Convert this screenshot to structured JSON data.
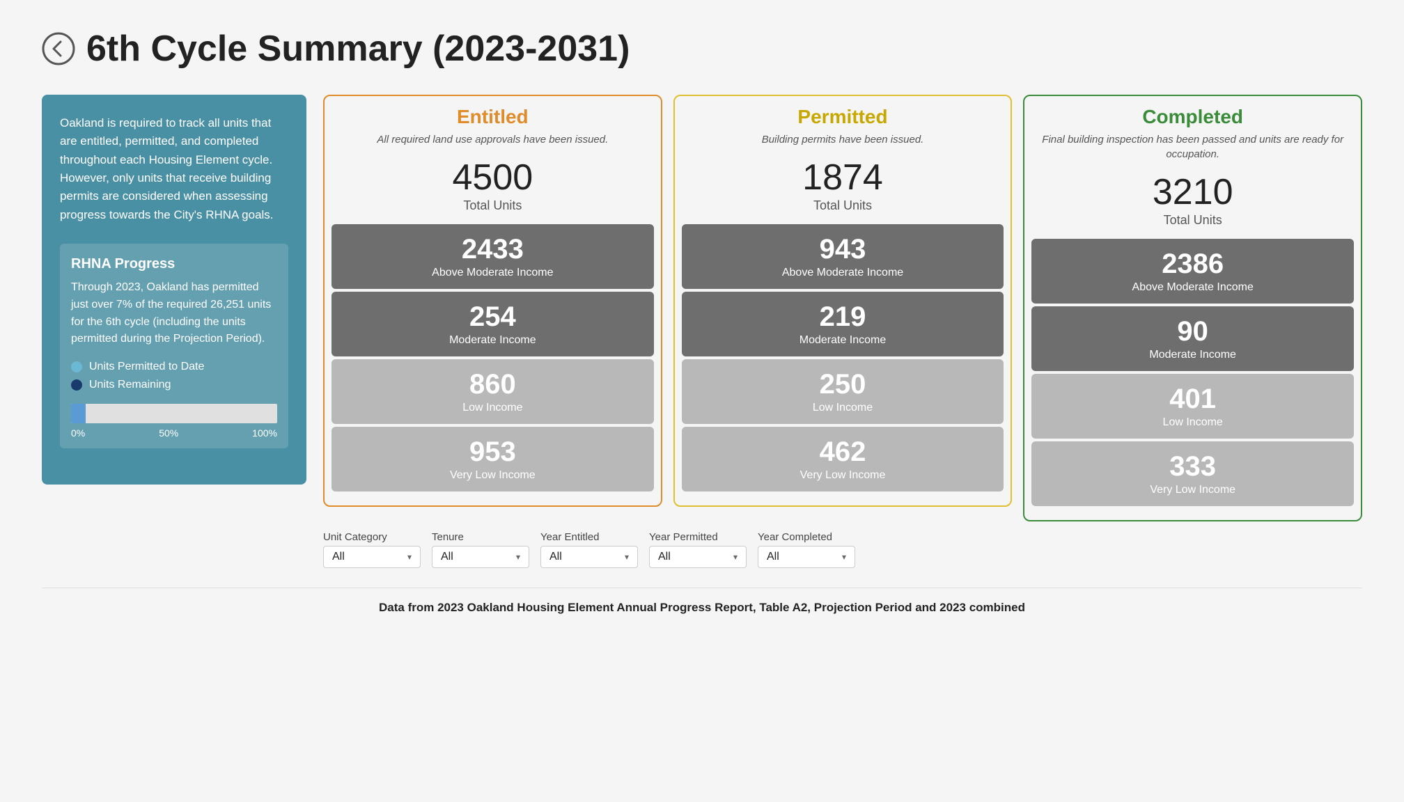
{
  "header": {
    "title": "6th Cycle Summary (2023-2031)"
  },
  "sidebar": {
    "description": "Oakland is required to track all units that are entitled, permitted, and completed throughout each Housing Element cycle. However, only units that receive building permits are considered when assessing progress towards the City's RHNA goals.",
    "rhna_title": "RHNA Progress",
    "rhna_text": "Through 2023, Oakland has permitted just over 7% of the required 26,251 units for the 6th cycle (including the units permitted during the Projection Period).",
    "legend": [
      {
        "label": "Units Permitted to Date",
        "type": "light"
      },
      {
        "label": "Units Remaining",
        "type": "dark"
      }
    ],
    "progress_percent": "7%",
    "progress_labels": [
      "0%",
      "50%",
      "100%"
    ]
  },
  "cards": [
    {
      "id": "entitled",
      "title": "Entitled",
      "subtitle": "All required land use approvals have been issued.",
      "border_color": "#e08c2a",
      "title_color": "#e08c2a",
      "total": "4500",
      "total_label": "Total Units",
      "income_blocks": [
        {
          "value": "2433",
          "label": "Above Moderate Income",
          "dark": true
        },
        {
          "value": "254",
          "label": "Moderate Income",
          "dark": true
        },
        {
          "value": "860",
          "label": "Low Income",
          "dark": false
        },
        {
          "value": "953",
          "label": "Very Low Income",
          "dark": false
        }
      ]
    },
    {
      "id": "permitted",
      "title": "Permitted",
      "subtitle": "Building permits have been issued.",
      "border_color": "#e0c030",
      "title_color": "#c8a800",
      "total": "1874",
      "total_label": "Total Units",
      "income_blocks": [
        {
          "value": "943",
          "label": "Above Moderate Income",
          "dark": true
        },
        {
          "value": "219",
          "label": "Moderate Income",
          "dark": true
        },
        {
          "value": "250",
          "label": "Low Income",
          "dark": false
        },
        {
          "value": "462",
          "label": "Very Low Income",
          "dark": false
        }
      ]
    },
    {
      "id": "completed",
      "title": "Completed",
      "subtitle": "Final building inspection has been passed and units are ready for occupation.",
      "border_color": "#3a8c3a",
      "title_color": "#3a8c3a",
      "total": "3210",
      "total_label": "Total Units",
      "income_blocks": [
        {
          "value": "2386",
          "label": "Above Moderate Income",
          "dark": true
        },
        {
          "value": "90",
          "label": "Moderate Income",
          "dark": true
        },
        {
          "value": "401",
          "label": "Low Income",
          "dark": false
        },
        {
          "value": "333",
          "label": "Very Low Income",
          "dark": false
        }
      ]
    }
  ],
  "filters": [
    {
      "label": "Unit Category",
      "value": "All"
    },
    {
      "label": "Tenure",
      "value": "All"
    },
    {
      "label": "Year Entitled",
      "value": "All"
    },
    {
      "label": "Year Permitted",
      "value": "All"
    },
    {
      "label": "Year Completed",
      "value": "All"
    }
  ],
  "footer": "Data from 2023 Oakland Housing Element Annual Progress Report, Table A2, Projection Period and 2023 combined"
}
